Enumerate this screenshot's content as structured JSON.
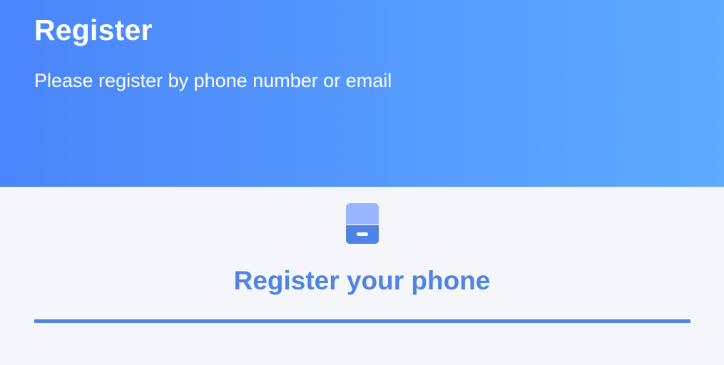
{
  "header": {
    "title": "Register",
    "subtitle": "Please register by phone number or email"
  },
  "section": {
    "icon": "phone-icon",
    "title": "Register your phone"
  },
  "colors": {
    "header_gradient_start": "#4a85fb",
    "header_gradient_end": "#5eabff",
    "accent": "#4f84e5",
    "background": "#f5f6fb"
  }
}
